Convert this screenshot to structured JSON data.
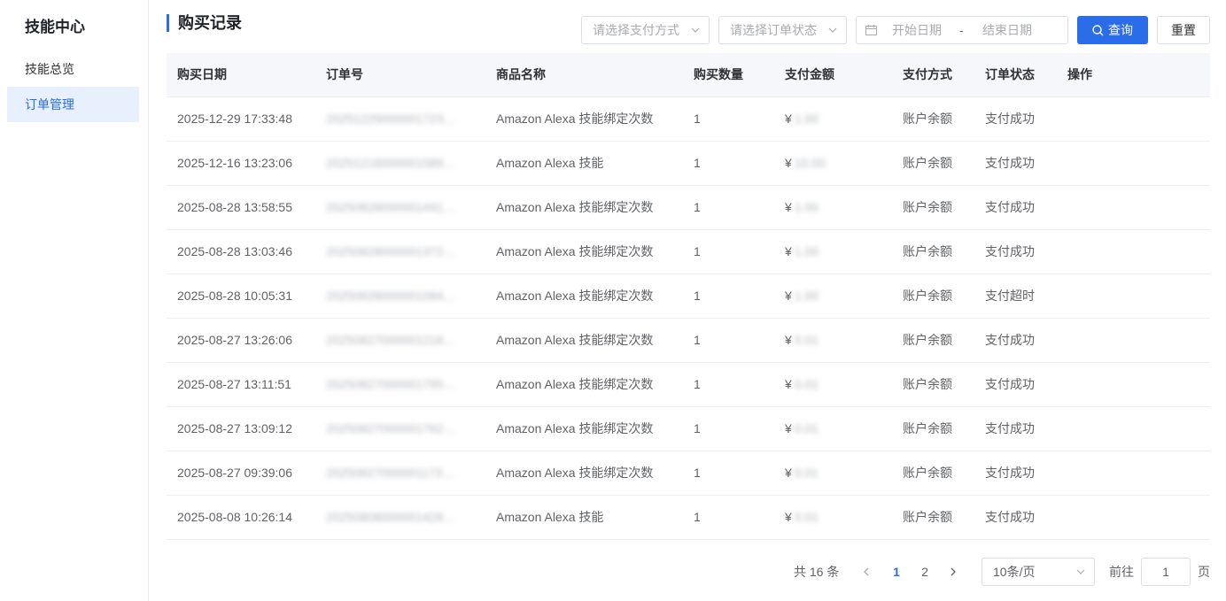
{
  "sidebar": {
    "title": "技能中心",
    "items": [
      {
        "label": "技能总览",
        "active": false
      },
      {
        "label": "订单管理",
        "active": true
      }
    ]
  },
  "header": {
    "title": "购买记录",
    "payment_select_placeholder": "请选择支付方式",
    "status_select_placeholder": "请选择订单状态",
    "start_date_placeholder": "开始日期",
    "date_separator": "-",
    "end_date_placeholder": "结束日期",
    "query_label": "查询",
    "reset_label": "重置"
  },
  "table": {
    "columns": [
      "购买日期",
      "订单号",
      "商品名称",
      "购买数量",
      "支付金额",
      "支付方式",
      "订单状态",
      "操作"
    ],
    "currency": "¥",
    "rows": [
      {
        "date": "2025-12-29 17:33:48",
        "order_no": "20251229000001723…",
        "product": "Amazon Alexa 技能绑定次数",
        "qty": "1",
        "amount": "1.00",
        "method": "账户余额",
        "status": "支付成功"
      },
      {
        "date": "2025-12-16 13:23:06",
        "order_no": "20251216000001589…",
        "product": "Amazon Alexa 技能",
        "qty": "1",
        "amount": "10.00",
        "method": "账户余额",
        "status": "支付成功"
      },
      {
        "date": "2025-08-28 13:58:55",
        "order_no": "20250828000001441…",
        "product": "Amazon Alexa 技能绑定次数",
        "qty": "1",
        "amount": "1.00",
        "method": "账户余额",
        "status": "支付成功"
      },
      {
        "date": "2025-08-28 13:03:46",
        "order_no": "20250828000001372…",
        "product": "Amazon Alexa 技能绑定次数",
        "qty": "1",
        "amount": "1.00",
        "method": "账户余额",
        "status": "支付成功"
      },
      {
        "date": "2025-08-28 10:05:31",
        "order_no": "20250828000001084…",
        "product": "Amazon Alexa 技能绑定次数",
        "qty": "1",
        "amount": "1.00",
        "method": "账户余额",
        "status": "支付超时"
      },
      {
        "date": "2025-08-27 13:26:06",
        "order_no": "20250827000001218…",
        "product": "Amazon Alexa 技能绑定次数",
        "qty": "1",
        "amount": "0.01",
        "method": "账户余额",
        "status": "支付成功"
      },
      {
        "date": "2025-08-27 13:11:51",
        "order_no": "20250827000001795…",
        "product": "Amazon Alexa 技能绑定次数",
        "qty": "1",
        "amount": "0.01",
        "method": "账户余额",
        "status": "支付成功"
      },
      {
        "date": "2025-08-27 13:09:12",
        "order_no": "20250827000001762…",
        "product": "Amazon Alexa 技能绑定次数",
        "qty": "1",
        "amount": "0.01",
        "method": "账户余额",
        "status": "支付成功"
      },
      {
        "date": "2025-08-27 09:39:06",
        "order_no": "20250827000001173…",
        "product": "Amazon Alexa 技能绑定次数",
        "qty": "1",
        "amount": "0.01",
        "method": "账户余额",
        "status": "支付成功"
      },
      {
        "date": "2025-08-08 10:26:14",
        "order_no": "20250808000001428…",
        "product": "Amazon Alexa 技能",
        "qty": "1",
        "amount": "0.01",
        "method": "账户余额",
        "status": "支付成功"
      }
    ]
  },
  "pagination": {
    "total_text": "共 16 条",
    "pages": [
      "1",
      "2"
    ],
    "current_page": "1",
    "page_size": "10条/页",
    "goto_label": "前往",
    "goto_value": "1",
    "page_unit": "页"
  },
  "colors": {
    "accent": "#2b6de8",
    "active_nav_bg": "#e8f0fe",
    "header_bg": "#f5f7fa"
  }
}
